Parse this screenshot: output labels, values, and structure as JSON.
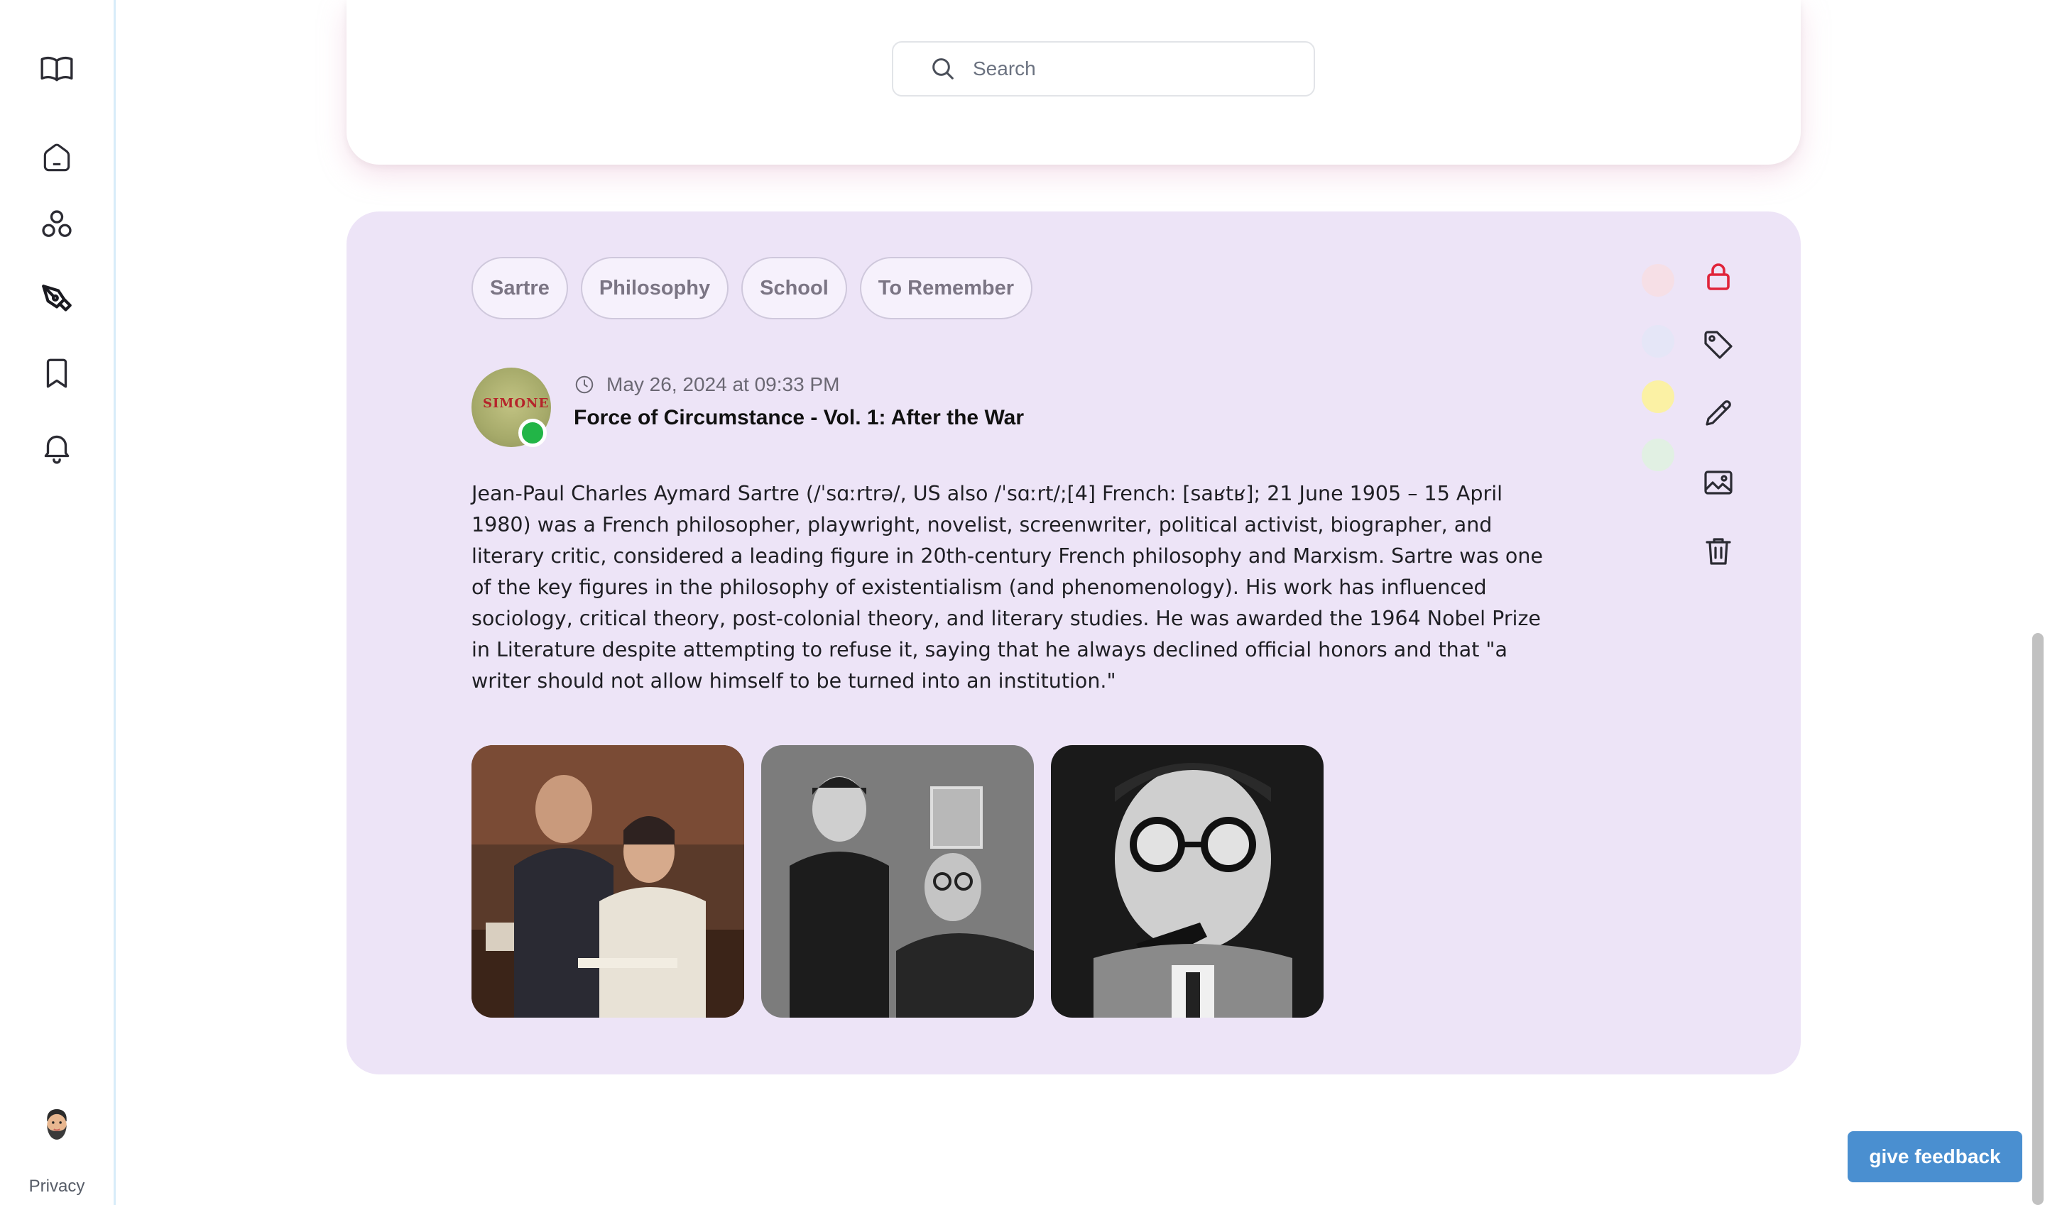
{
  "sidebar": {
    "icons": [
      "book-open-icon",
      "home-icon",
      "circles-icon",
      "pen-nib-icon",
      "bookmark-icon",
      "bell-icon"
    ],
    "privacy_label": "Privacy"
  },
  "search": {
    "placeholder": "Search"
  },
  "note": {
    "tags": [
      "Sartre",
      "Philosophy",
      "School",
      "To Remember"
    ],
    "date": "May 26, 2024 at 09:33 PM",
    "book_title": "Force of Circumstance - Vol. 1: After the War",
    "book_cover_text": "SIMONE",
    "body": "Jean-Paul Charles Aymard Sartre (/ˈsɑːrtrə/, US also /ˈsɑːrt/;[4] French: [saʁtʁ]; 21 June 1905 – 15 April 1980) was a French philosopher, playwright, novelist, screenwriter, political activist, biographer, and literary critic, considered a leading figure in 20th-century French philosophy and Marxism. Sartre was one of the key figures in the philosophy of existentialism (and phenomenology). His work has influenced sociology, critical theory, post-colonial theory, and literary studies. He was awarded the 1964 Nobel Prize in Literature despite attempting to refuse it, saying that he always declined official honors and that \"a writer should not allow himself to be turned into an institution.\"",
    "color_options": [
      "#f6dfe6",
      "#e5e6f7",
      "#fbf1a4",
      "#e1f0e3"
    ],
    "action_icons": [
      "lock-icon",
      "tag-icon",
      "pencil-icon",
      "image-icon",
      "trash-icon"
    ],
    "lock_color": "#e0243a",
    "online_status_color": "#22b547"
  },
  "feedback_label": "give feedback"
}
